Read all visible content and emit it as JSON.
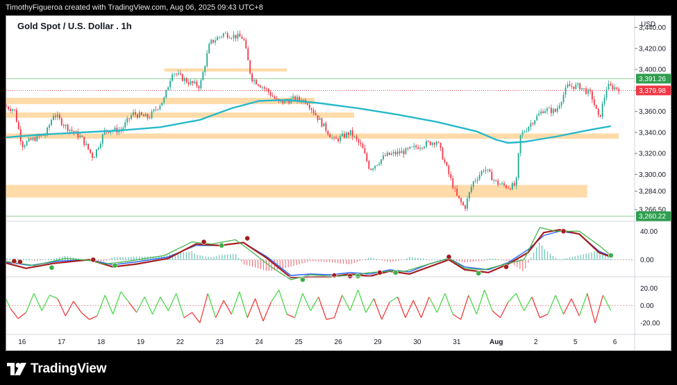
{
  "header": {
    "credit": "TimothyFigueroa created with TradingView.com, Aug 06, 2025 09:43 UTC+8"
  },
  "brand": {
    "name": "TradingView"
  },
  "colors": {
    "up": "#22ab94",
    "down": "#f23645",
    "ma": "#26b8c9",
    "zone": "#ffd59a",
    "hline": "#8fce95",
    "price_red": "#f23645",
    "price_green": "#2e9e4f",
    "mom_green": "#3cb044",
    "mom_red": "#a51d1d",
    "mom_blue": "#2962ff",
    "osc_green": "#4cd94c",
    "osc_red": "#ef3b3b"
  },
  "chart_data": [
    {
      "type": "candlestick",
      "title": "Gold Spot / U.S. Dollar . 1h",
      "currency": "USD",
      "y_ticks": [
        3440,
        3420,
        3400,
        3380,
        3360,
        3340,
        3320,
        3300,
        3284,
        3266.5
      ],
      "y_tick_labels": [
        "3,440.00",
        "3,420.00",
        "3,400.00",
        "3,380.00",
        "3,360.00",
        "3,340.00",
        "3,320.00",
        "3,300.00",
        "3,284.00",
        "3,266.50"
      ],
      "ylim": [
        3258,
        3447
      ],
      "x_labels": [
        "16",
        "17",
        "18",
        "19",
        "22",
        "23",
        "24",
        "25",
        "26",
        "29",
        "30",
        "31",
        "Aug",
        "2",
        "5",
        "6"
      ],
      "x_label_positions": [
        0.5,
        1.5,
        2.5,
        3.5,
        4.5,
        5.5,
        6.5,
        7.5,
        8.5,
        9.5,
        10.5,
        11.5,
        12.5,
        13.5,
        14.5,
        15.5
      ],
      "xlim": [
        0.1,
        16.0
      ],
      "price_labels": [
        {
          "value": 3391.26,
          "label": "3,391.26",
          "color": "green"
        },
        {
          "value": 3379.98,
          "label": "3,379.98",
          "color": "red"
        },
        {
          "value": 3260.22,
          "label": "3,260.22",
          "color": "green"
        }
      ],
      "zones": [
        {
          "x0": 0.05,
          "x1": 7.9,
          "y0": 3367,
          "y1": 3373
        },
        {
          "x0": 0.05,
          "x1": 8.9,
          "y0": 3354,
          "y1": 3359
        },
        {
          "x0": 0.05,
          "x1": 15.6,
          "y0": 3334,
          "y1": 3339
        },
        {
          "x0": 0.05,
          "x1": 14.8,
          "y0": 3278,
          "y1": 3290
        },
        {
          "x0": 4.1,
          "x1": 7.2,
          "y0": 3398,
          "y1": 3401
        }
      ],
      "ma_points": [
        [
          0.0,
          3335
        ],
        [
          1.0,
          3338
        ],
        [
          2.0,
          3340
        ],
        [
          3.0,
          3342
        ],
        [
          4.0,
          3345
        ],
        [
          5.0,
          3352
        ],
        [
          5.8,
          3363
        ],
        [
          6.5,
          3370
        ],
        [
          7.2,
          3371
        ],
        [
          8.0,
          3368
        ],
        [
          9.0,
          3363
        ],
        [
          10.0,
          3357
        ],
        [
          11.0,
          3350
        ],
        [
          12.0,
          3341
        ],
        [
          12.5,
          3333
        ],
        [
          12.8,
          3330
        ],
        [
          13.2,
          3331
        ],
        [
          14.0,
          3336
        ],
        [
          14.8,
          3342
        ],
        [
          15.4,
          3346
        ]
      ],
      "close_path": [
        [
          0.05,
          3365
        ],
        [
          0.3,
          3362
        ],
        [
          0.5,
          3328
        ],
        [
          0.8,
          3334
        ],
        [
          1.1,
          3338
        ],
        [
          1.3,
          3358
        ],
        [
          1.6,
          3346
        ],
        [
          2.0,
          3335
        ],
        [
          2.3,
          3316
        ],
        [
          2.6,
          3342
        ],
        [
          3.0,
          3342
        ],
        [
          3.3,
          3358
        ],
        [
          3.7,
          3354
        ],
        [
          4.1,
          3372
        ],
        [
          4.3,
          3398
        ],
        [
          4.7,
          3388
        ],
        [
          5.0,
          3384
        ],
        [
          5.25,
          3425
        ],
        [
          5.6,
          3434
        ],
        [
          6.1,
          3430
        ],
        [
          6.3,
          3392
        ],
        [
          6.7,
          3380
        ],
        [
          7.0,
          3368
        ],
        [
          7.4,
          3372
        ],
        [
          7.7,
          3370
        ],
        [
          8.0,
          3353
        ],
        [
          8.4,
          3332
        ],
        [
          8.8,
          3340
        ],
        [
          9.1,
          3326
        ],
        [
          9.3,
          3305
        ],
        [
          9.7,
          3318
        ],
        [
          10.2,
          3322
        ],
        [
          10.6,
          3328
        ],
        [
          11.0,
          3332
        ],
        [
          11.3,
          3300
        ],
        [
          11.5,
          3279
        ],
        [
          11.7,
          3268
        ],
        [
          11.9,
          3292
        ],
        [
          12.2,
          3306
        ],
        [
          12.5,
          3292
        ],
        [
          12.8,
          3288
        ],
        [
          13.0,
          3290
        ],
        [
          13.1,
          3336
        ],
        [
          13.4,
          3350
        ],
        [
          13.7,
          3362
        ],
        [
          14.0,
          3360
        ],
        [
          14.3,
          3384
        ],
        [
          14.6,
          3384
        ],
        [
          14.9,
          3376
        ],
        [
          15.1,
          3352
        ],
        [
          15.3,
          3384
        ],
        [
          15.6,
          3382
        ]
      ]
    },
    {
      "type": "line",
      "y_tick_labels": [
        "40.00",
        "0.00"
      ],
      "ylim": [
        -20,
        50
      ],
      "zero": 0,
      "green_points": [
        [
          0.05,
          -2
        ],
        [
          0.8,
          -8
        ],
        [
          1.6,
          2
        ],
        [
          2.2,
          -1
        ],
        [
          2.6,
          -6
        ],
        [
          3.2,
          -2
        ],
        [
          4.1,
          6
        ],
        [
          4.8,
          25
        ],
        [
          5.3,
          22
        ],
        [
          5.9,
          28
        ],
        [
          6.2,
          16
        ],
        [
          6.8,
          -10
        ],
        [
          7.3,
          -28
        ],
        [
          7.8,
          -21
        ],
        [
          8.3,
          -23
        ],
        [
          8.8,
          -22
        ],
        [
          9.3,
          -18
        ],
        [
          9.8,
          -16
        ],
        [
          10.2,
          -16
        ],
        [
          10.8,
          -6
        ],
        [
          11.3,
          2
        ],
        [
          11.7,
          -12
        ],
        [
          12.2,
          -14
        ],
        [
          12.8,
          -5
        ],
        [
          13.2,
          0
        ],
        [
          13.6,
          45
        ],
        [
          14.0,
          40
        ],
        [
          14.6,
          40
        ],
        [
          15.1,
          20
        ],
        [
          15.4,
          6
        ]
      ],
      "red_points": [
        [
          0.05,
          -4
        ],
        [
          0.6,
          -12
        ],
        [
          1.3,
          -5
        ],
        [
          2.2,
          0
        ],
        [
          2.8,
          -10
        ],
        [
          3.4,
          -6
        ],
        [
          4.2,
          2
        ],
        [
          4.9,
          22
        ],
        [
          5.5,
          20
        ],
        [
          6.1,
          24
        ],
        [
          6.7,
          2
        ],
        [
          7.3,
          -25
        ],
        [
          7.8,
          -24
        ],
        [
          8.3,
          -24
        ],
        [
          8.8,
          -20
        ],
        [
          9.3,
          -23
        ],
        [
          9.8,
          -16
        ],
        [
          10.3,
          -20
        ],
        [
          10.8,
          -10
        ],
        [
          11.3,
          0
        ],
        [
          11.7,
          -14
        ],
        [
          12.3,
          -18
        ],
        [
          12.8,
          -6
        ],
        [
          13.3,
          10
        ],
        [
          13.7,
          38
        ],
        [
          14.1,
          42
        ],
        [
          14.6,
          36
        ],
        [
          15.1,
          10
        ],
        [
          15.4,
          4
        ]
      ],
      "blue_points": [
        [
          0.05,
          -3
        ],
        [
          0.7,
          -8
        ],
        [
          1.4,
          -2
        ],
        [
          2.2,
          0
        ],
        [
          2.8,
          -7
        ],
        [
          3.4,
          -3
        ],
        [
          4.2,
          4
        ],
        [
          4.9,
          20
        ],
        [
          5.5,
          20
        ],
        [
          6.1,
          24
        ],
        [
          6.7,
          4
        ],
        [
          7.3,
          -22
        ],
        [
          7.8,
          -20
        ],
        [
          8.3,
          -21
        ],
        [
          8.8,
          -18
        ],
        [
          9.3,
          -20
        ],
        [
          9.8,
          -14
        ],
        [
          10.3,
          -17
        ],
        [
          10.8,
          -6
        ],
        [
          11.3,
          2
        ],
        [
          11.7,
          -10
        ],
        [
          12.3,
          -14
        ],
        [
          12.8,
          -4
        ],
        [
          13.3,
          14
        ],
        [
          13.7,
          34
        ],
        [
          14.1,
          40
        ],
        [
          14.6,
          36
        ],
        [
          15.1,
          12
        ],
        [
          15.4,
          5
        ]
      ],
      "signal_dots": [
        {
          "x": 0.3,
          "y": -2,
          "c": "red"
        },
        {
          "x": 0.45,
          "y": -3,
          "c": "red"
        },
        {
          "x": 1.25,
          "y": -11,
          "c": "green"
        },
        {
          "x": 2.3,
          "y": 0,
          "c": "red"
        },
        {
          "x": 2.85,
          "y": -8,
          "c": "green"
        },
        {
          "x": 5.1,
          "y": 25,
          "c": "red"
        },
        {
          "x": 5.55,
          "y": 20,
          "c": "green"
        },
        {
          "x": 6.2,
          "y": 30,
          "c": "red"
        },
        {
          "x": 7.6,
          "y": -28,
          "c": "green"
        },
        {
          "x": 8.4,
          "y": -22,
          "c": "red"
        },
        {
          "x": 8.8,
          "y": -23,
          "c": "red"
        },
        {
          "x": 9.0,
          "y": -23,
          "c": "green"
        },
        {
          "x": 9.55,
          "y": -18,
          "c": "red"
        },
        {
          "x": 9.95,
          "y": -18,
          "c": "green"
        },
        {
          "x": 11.3,
          "y": 4,
          "c": "red"
        },
        {
          "x": 12.05,
          "y": -19,
          "c": "green"
        },
        {
          "x": 12.75,
          "y": -10,
          "c": "red"
        },
        {
          "x": 14.2,
          "y": 40,
          "c": "red"
        },
        {
          "x": 15.4,
          "y": 6,
          "c": "green"
        }
      ]
    },
    {
      "type": "line",
      "y_tick_labels": [
        "20.00",
        "0.00",
        "-20.00"
      ],
      "y_ticks": [
        20,
        0,
        -20
      ],
      "ylim": [
        -30,
        30
      ],
      "zero": 0,
      "osc_points": [
        [
          0.05,
          12
        ],
        [
          0.2,
          -3
        ],
        [
          0.4,
          -15
        ],
        [
          0.6,
          -8
        ],
        [
          0.8,
          14
        ],
        [
          1.0,
          -6
        ],
        [
          1.2,
          12
        ],
        [
          1.4,
          8
        ],
        [
          1.6,
          -12
        ],
        [
          1.8,
          5
        ],
        [
          2.0,
          -8
        ],
        [
          2.2,
          -16
        ],
        [
          2.4,
          -12
        ],
        [
          2.6,
          12
        ],
        [
          2.8,
          -10
        ],
        [
          3.0,
          16
        ],
        [
          3.2,
          4
        ],
        [
          3.4,
          -8
        ],
        [
          3.6,
          10
        ],
        [
          3.8,
          -10
        ],
        [
          4.0,
          10
        ],
        [
          4.2,
          -6
        ],
        [
          4.4,
          14
        ],
        [
          4.6,
          -14
        ],
        [
          4.8,
          -8
        ],
        [
          5.0,
          -20
        ],
        [
          5.2,
          14
        ],
        [
          5.4,
          -14
        ],
        [
          5.6,
          6
        ],
        [
          5.8,
          -10
        ],
        [
          6.0,
          16
        ],
        [
          6.2,
          -14
        ],
        [
          6.4,
          8
        ],
        [
          6.6,
          -18
        ],
        [
          6.8,
          4
        ],
        [
          7.0,
          18
        ],
        [
          7.2,
          -10
        ],
        [
          7.4,
          -14
        ],
        [
          7.6,
          14
        ],
        [
          7.8,
          -6
        ],
        [
          8.0,
          10
        ],
        [
          8.2,
          -16
        ],
        [
          8.4,
          -14
        ],
        [
          8.6,
          12
        ],
        [
          8.8,
          -6
        ],
        [
          9.0,
          18
        ],
        [
          9.2,
          -8
        ],
        [
          9.4,
          8
        ],
        [
          9.6,
          -16
        ],
        [
          9.8,
          4
        ],
        [
          10.0,
          10
        ],
        [
          10.2,
          -14
        ],
        [
          10.4,
          6
        ],
        [
          10.6,
          -14
        ],
        [
          10.8,
          10
        ],
        [
          11.0,
          -8
        ],
        [
          11.2,
          14
        ],
        [
          11.4,
          -10
        ],
        [
          11.6,
          -16
        ],
        [
          11.8,
          12
        ],
        [
          12.0,
          -10
        ],
        [
          12.2,
          18
        ],
        [
          12.4,
          -6
        ],
        [
          12.6,
          -14
        ],
        [
          12.8,
          4
        ],
        [
          13.0,
          14
        ],
        [
          13.2,
          -6
        ],
        [
          13.4,
          10
        ],
        [
          13.6,
          -14
        ],
        [
          13.8,
          -10
        ],
        [
          14.0,
          12
        ],
        [
          14.2,
          -10
        ],
        [
          14.4,
          8
        ],
        [
          14.6,
          -12
        ],
        [
          14.8,
          14
        ],
        [
          15.0,
          -20
        ],
        [
          15.2,
          12
        ],
        [
          15.4,
          -6
        ]
      ]
    }
  ]
}
